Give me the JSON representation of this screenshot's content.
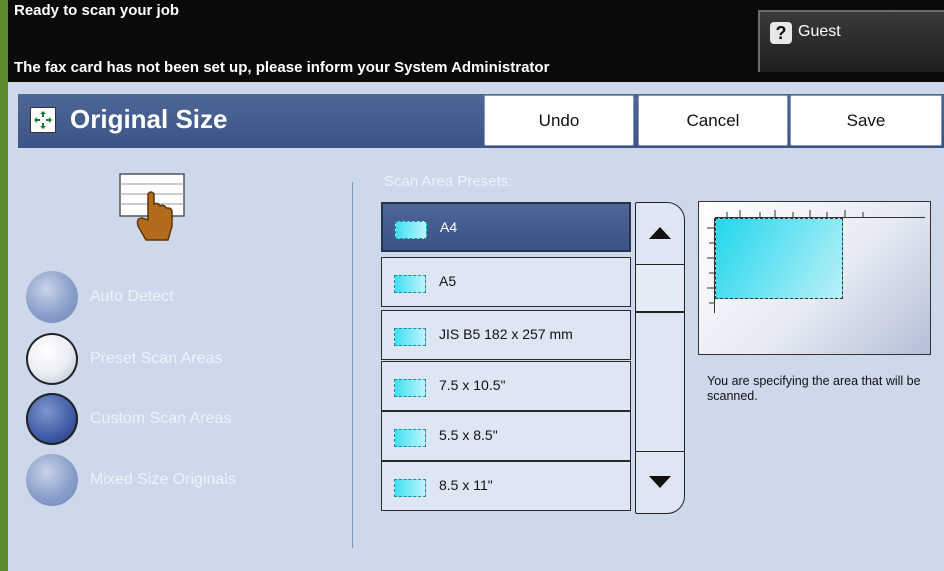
{
  "status": {
    "line1": "Ready to scan your job",
    "line2": "The fax card has not been set up, please inform your System Administrator"
  },
  "user": {
    "icon": "help-icon",
    "icon_glyph": "?",
    "label": "Guest"
  },
  "header": {
    "title": "Original Size",
    "icon": "original-size-icon",
    "undo_label": "Undo",
    "cancel_label": "Cancel",
    "save_label": "Save"
  },
  "colors": {
    "title_bar": "#4f6797",
    "panel_bg": "#cdd8ea",
    "accent_edge": "#5c8a2c",
    "swatch": "#3fe0f0"
  },
  "modes": [
    {
      "label": "Auto Detect",
      "state": "unselected"
    },
    {
      "label": "Preset Scan Areas",
      "state": "selected"
    },
    {
      "label": "Custom Scan Areas",
      "state": "unselected"
    },
    {
      "label": "Mixed Size Originals",
      "state": "unselected"
    }
  ],
  "presets": {
    "label": "Scan Area Presets:",
    "selected_index": 0,
    "items": [
      {
        "label": "A4"
      },
      {
        "label": "A5"
      },
      {
        "label": "JIS B5 182 x 257 mm"
      },
      {
        "label": "7.5 x 10.5\""
      },
      {
        "label": "5.5 x 8.5\""
      },
      {
        "label": "8.5 x 11\""
      }
    ]
  },
  "scroll": {
    "up_icon": "arrow-up-icon",
    "down_icon": "arrow-down-icon"
  },
  "preview": {
    "description": "You are specifying the area that will be scanned."
  }
}
